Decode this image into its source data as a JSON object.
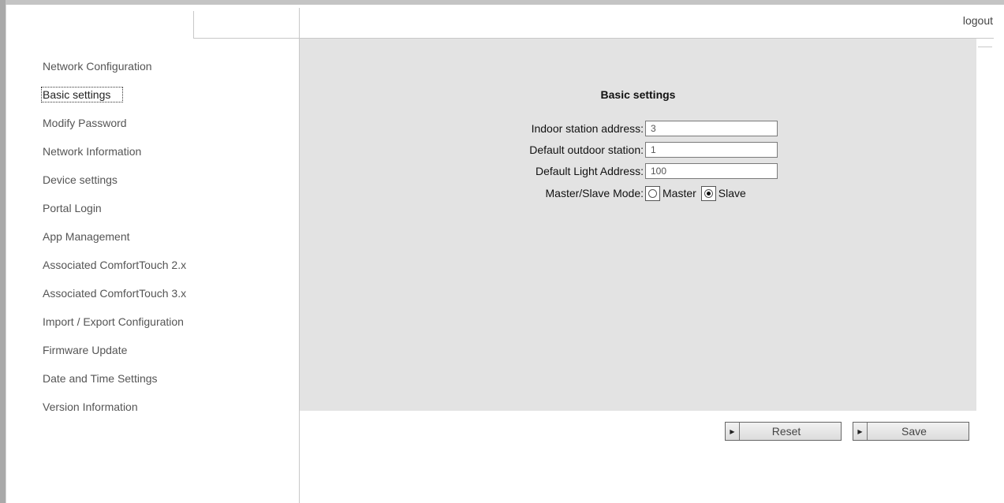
{
  "header": {
    "logout_label": "logout"
  },
  "sidebar": {
    "items": [
      {
        "label": "Network Configuration"
      },
      {
        "label": "Basic settings",
        "active": true
      },
      {
        "label": "Modify Password"
      },
      {
        "label": "Network Information"
      },
      {
        "label": "Device settings"
      },
      {
        "label": "Portal Login"
      },
      {
        "label": "App Management"
      },
      {
        "label": "Associated ComfortTouch 2.x"
      },
      {
        "label": "Associated ComfortTouch 3.x"
      },
      {
        "label": "Import / Export Configuration"
      },
      {
        "label": "Firmware Update"
      },
      {
        "label": "Date and Time Settings"
      },
      {
        "label": "Version Information"
      }
    ]
  },
  "form": {
    "title": "Basic settings",
    "indoor_station_label": "Indoor station address:",
    "indoor_station_value": "3",
    "default_outdoor_label": "Default outdoor station:",
    "default_outdoor_value": "1",
    "default_light_label": "Default Light Address:",
    "default_light_value": "100",
    "mode_label": "Master/Slave Mode:",
    "mode_options": [
      "Master",
      "Slave"
    ],
    "mode_selected": "Slave"
  },
  "actions": {
    "reset_label": "Reset",
    "save_label": "Save"
  },
  "colors": {
    "panel_bg": "#e3e3e3",
    "frame": "#a9a9a9"
  }
}
